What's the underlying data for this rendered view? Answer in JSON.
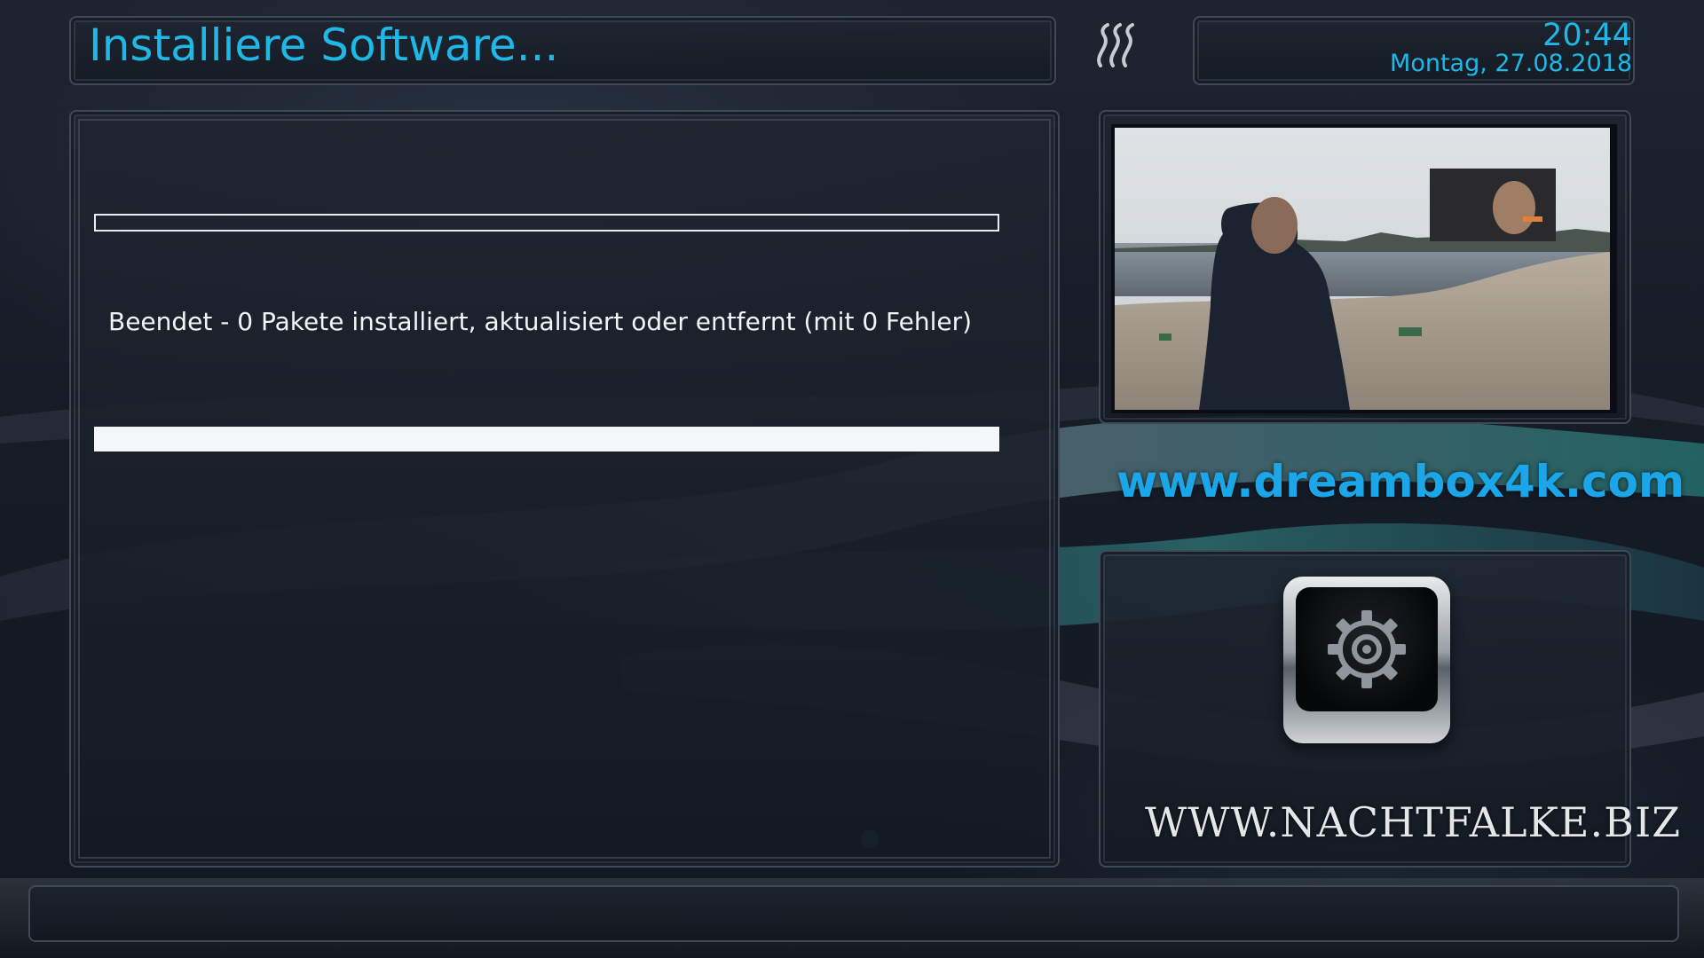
{
  "header": {
    "title": "Installiere Software...",
    "logo_icon": "waves-icon"
  },
  "clock": {
    "time": "20:44",
    "date": "Montag, 27.08.2018"
  },
  "main": {
    "progress_bar_top": {
      "value": 0,
      "icon": "progress-bar-outline"
    },
    "status_text": "Beendet - 0 Pakete installiert, aktualisiert oder entfernt (mit 0 Fehler)",
    "progress_bar_bottom": {
      "value": 1.0
    }
  },
  "sidebar": {
    "tv_preview_icon": "live-tv-preview",
    "website": "www.dreambox4k.com",
    "software_icon": "gear-icon",
    "brand": "WWW.NACHTFALKE.BIZ"
  },
  "colors": {
    "accent": "#1fb8e6",
    "link": "#1aa6e8",
    "background": "#161c26",
    "text": "#f2f4f6"
  }
}
